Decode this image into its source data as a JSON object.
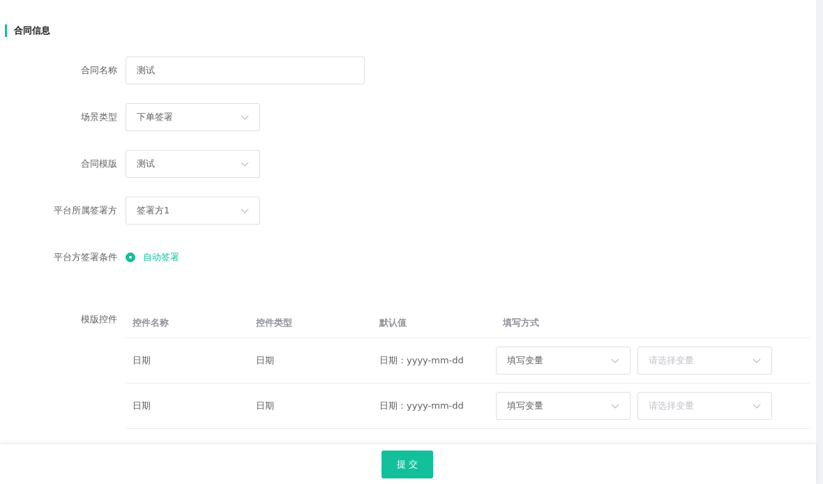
{
  "section_title": "合同信息",
  "fields": [
    {
      "label": "合同名称",
      "kind": "input",
      "value": "测试"
    },
    {
      "label": "场景类型",
      "kind": "select",
      "value": "下单签署"
    },
    {
      "label": "合同模版",
      "kind": "select",
      "value": "测试"
    },
    {
      "label": "平台所属签署方",
      "kind": "select",
      "value": "签署方1"
    }
  ],
  "sign_condition": {
    "label": "平台方签署条件",
    "options": [
      {
        "label": "自动签署",
        "selected": true
      }
    ]
  },
  "controls_table": {
    "label": "模版控件",
    "columns": [
      "控件名称",
      "控件类型",
      "默认值",
      "填写方式"
    ],
    "rows": [
      {
        "name": "日期",
        "type": "日期",
        "default": "日期：yyyy-mm-dd",
        "fill_mode": "填写变量",
        "variable_placeholder": "请选择变量"
      },
      {
        "name": "日期",
        "type": "日期",
        "default": "日期：yyyy-mm-dd",
        "fill_mode": "填写变量",
        "variable_placeholder": "请选择变量"
      }
    ]
  },
  "submit_button": "提 交"
}
